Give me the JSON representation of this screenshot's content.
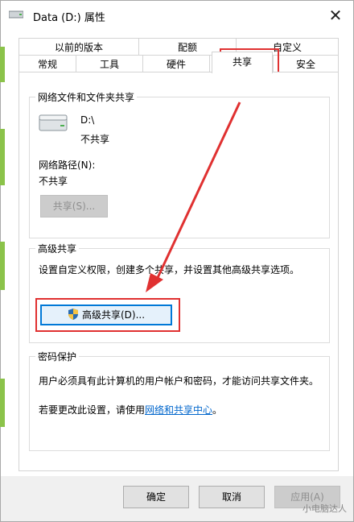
{
  "window": {
    "title": "Data (D:) 属性",
    "close_symbol": "✕"
  },
  "tabs": {
    "row1": [
      "以前的版本",
      "配额",
      "自定义"
    ],
    "row2": [
      "常规",
      "工具",
      "硬件",
      "共享",
      "安全"
    ],
    "selected": "共享"
  },
  "network_sharing": {
    "group_title": "网络文件和文件夹共享",
    "drive_label": "D:\\",
    "status": "不共享",
    "network_path_label": "网络路径(N):",
    "network_path_value": "不共享",
    "share_button_label": "共享(S)..."
  },
  "advanced_sharing": {
    "group_title": "高级共享",
    "description": "设置自定义权限，创建多个共享，并设置其他高级共享选项。",
    "button_label": "高级共享(D)..."
  },
  "password_protection": {
    "group_title": "密码保护",
    "description": "用户必须具有此计算机的用户帐户和密码，才能访问共享文件夹。",
    "change_prefix": "若要更改此设置，请使用",
    "link_text": "网络和共享中心",
    "change_suffix": "。"
  },
  "footer": {
    "ok_label": "确定",
    "cancel_label": "取消",
    "apply_label": "应用(A)"
  },
  "annotation": {
    "highlight_color": "#e03131",
    "green_accent": "#8bc34a"
  },
  "watermark": "小电脑达人"
}
